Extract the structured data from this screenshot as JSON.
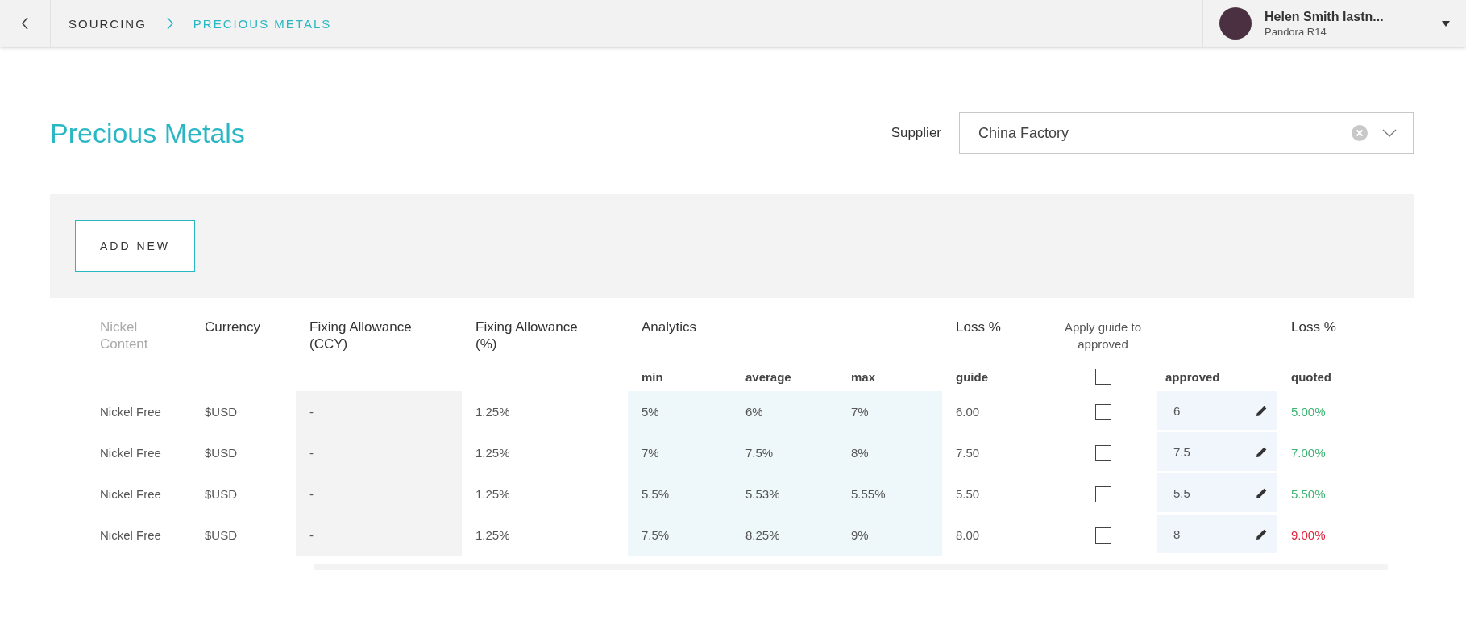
{
  "breadcrumb": [
    {
      "label": "SOURCING",
      "selected": false
    },
    {
      "label": "PRECIOUS METALS",
      "selected": true
    }
  ],
  "user": {
    "name": "Helen Smith lastn...",
    "subtitle": "Pandora R14"
  },
  "page_title": "Precious Metals",
  "supplier": {
    "label": "Supplier",
    "value": "China Factory"
  },
  "add_button": "ADD NEW",
  "table": {
    "columns": {
      "nickel_content": "Nickel Content",
      "currency": "Currency",
      "fixing_ccy": "Fixing Allowance (CCY)",
      "fixing_pct": "Fixing Allowance (%)",
      "analytics": "Analytics",
      "min": "min",
      "average": "average",
      "max": "max",
      "loss_guide_top": "Loss %",
      "guide": "guide",
      "apply": "Apply guide to approved",
      "apply_all_checked": false,
      "approved": "approved",
      "loss_quoted_top": "Loss %",
      "quoted": "quoted"
    },
    "rows": [
      {
        "nickel_content": "Nickel Free",
        "currency": "$USD",
        "fixing_ccy": "-",
        "fixing_pct": "1.25%",
        "min": "5%",
        "average": "6%",
        "max": "7%",
        "guide": "6.00",
        "apply_checked": false,
        "approved": "6",
        "quoted": "5.00%",
        "color": "#3cb371"
      },
      {
        "nickel_content": "Nickel Free",
        "currency": "$USD",
        "fixing_ccy": "-",
        "fixing_pct": "1.25%",
        "min": "7%",
        "average": "7.5%",
        "max": "8%",
        "guide": "7.50",
        "apply_checked": false,
        "approved": "7.5",
        "quoted": "7.00%",
        "color": "#3cb371"
      },
      {
        "nickel_content": "Nickel Free",
        "currency": "$USD",
        "fixing_ccy": "-",
        "fixing_pct": "1.25%",
        "min": "5.5%",
        "average": "5.53%",
        "max": "5.55%",
        "guide": "5.50",
        "apply_checked": false,
        "approved": "5.5",
        "quoted": "5.50%",
        "color": "#3cb371"
      },
      {
        "nickel_content": "Nickel Free",
        "currency": "$USD",
        "fixing_ccy": "-",
        "fixing_pct": "1.25%",
        "min": "7.5%",
        "average": "8.25%",
        "max": "9%",
        "guide": "8.00",
        "apply_checked": false,
        "approved": "8",
        "quoted": "9.00%",
        "color": "#e0243c"
      }
    ]
  }
}
